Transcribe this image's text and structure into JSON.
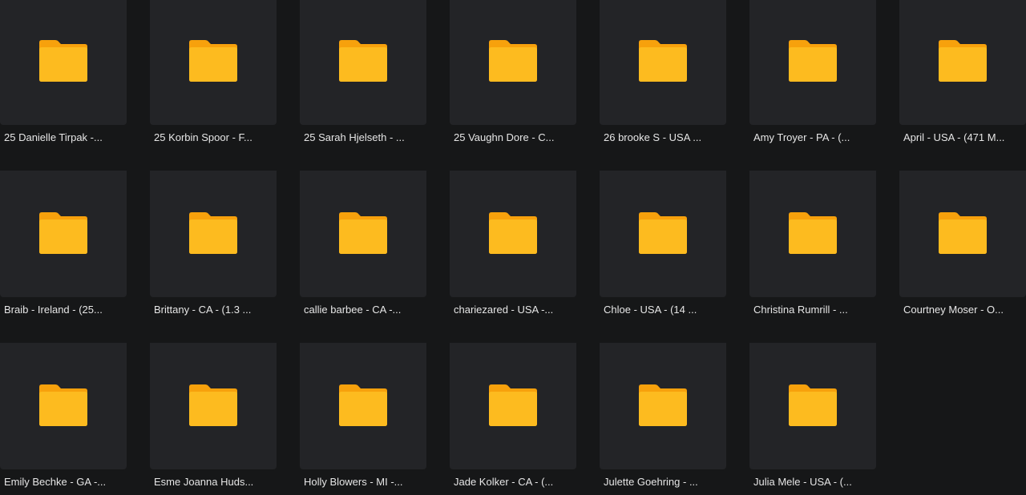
{
  "folders": [
    {
      "name": "25 Danielle Tirpak -..."
    },
    {
      "name": "25 Korbin Spoor - F..."
    },
    {
      "name": "25 Sarah Hjelseth - ..."
    },
    {
      "name": "25 Vaughn Dore - C..."
    },
    {
      "name": "26 brooke S - USA ..."
    },
    {
      "name": "Amy Troyer - PA - (..."
    },
    {
      "name": "April - USA - (471 M..."
    },
    {
      "name": "Braib - Ireland - (25..."
    },
    {
      "name": "Brittany - CA - (1.3 ..."
    },
    {
      "name": "callie barbee - CA -..."
    },
    {
      "name": "chariezared - USA -..."
    },
    {
      "name": "Chloe - USA - (14 ..."
    },
    {
      "name": "Christina Rumrill - ..."
    },
    {
      "name": "Courtney Moser - O..."
    },
    {
      "name": "Emily Bechke - GA -..."
    },
    {
      "name": "Esme Joanna Huds..."
    },
    {
      "name": "Holly Blowers - MI -..."
    },
    {
      "name": "Jade Kolker - CA - (..."
    },
    {
      "name": "Julette Goehring - ..."
    },
    {
      "name": "Julia Mele - USA - (..."
    }
  ],
  "colors": {
    "background": "#161718",
    "tile": "#232427",
    "folder_top": "#fdbf22",
    "folder_bottom": "#f9a20f",
    "label": "#e6e6e6"
  },
  "icons": {
    "folder": "folder-icon"
  }
}
